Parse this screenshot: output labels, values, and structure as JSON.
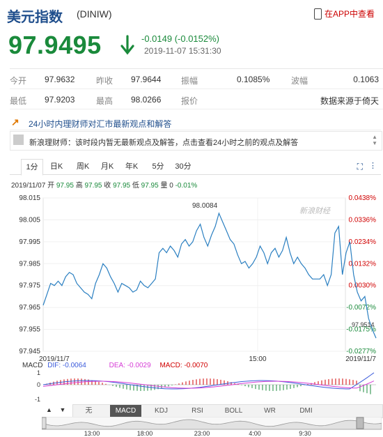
{
  "header": {
    "title": "美元指数",
    "code": "(DINIW)",
    "app_link": "在APP中查看"
  },
  "quote": {
    "price": "97.9495",
    "change": "-0.0149 (-0.0152%)",
    "timestamp": "2019-11-07 15:31:30"
  },
  "stats": {
    "row1": [
      {
        "label": "今开",
        "value": "97.9632"
      },
      {
        "label": "昨收",
        "value": "97.9644"
      },
      {
        "label": "振幅",
        "value": "0.1085%"
      },
      {
        "label": "波幅",
        "value": "0.1063"
      }
    ],
    "row2": [
      {
        "label": "最低",
        "value": "97.9203"
      },
      {
        "label": "最高",
        "value": "98.0266"
      },
      {
        "label": "报价",
        "value": ""
      },
      {
        "label": "",
        "value": "数据来源于倚天"
      }
    ]
  },
  "notice": {
    "text": "24小时内理财师对汇市最新观点和解答"
  },
  "message": {
    "text": "新浪理财师：该时段内暂无最新观点及解答，点击查看24小时之前的观点及解答"
  },
  "period_tabs": [
    "1分",
    "日K",
    "周K",
    "月K",
    "年K",
    "5分",
    "30分"
  ],
  "active_period": "1分",
  "info_line": {
    "date": "2019/11/07",
    "open_label": "开",
    "open": "97.95",
    "high_label": "高",
    "high": "97.95",
    "close_label": "收",
    "close": "97.95",
    "low_label": "低",
    "low": "97.95",
    "vol": "量 0",
    "pct": "-0.01%"
  },
  "chart_data": {
    "type": "line",
    "x_labels": [
      "2019/11/7",
      "15:00",
      "2019/11/7"
    ],
    "y_ticks": [
      "98.015",
      "98.005",
      "97.995",
      "97.985",
      "97.975",
      "97.965",
      "97.955",
      "97.945"
    ],
    "ylim": [
      97.945,
      98.015
    ],
    "right_ticks": [
      {
        "text": "0.0438%",
        "color": "#d00000"
      },
      {
        "text": "0.0336%",
        "color": "#d00000"
      },
      {
        "text": "0.0234%",
        "color": "#d00000"
      },
      {
        "text": "0.0132%",
        "color": "#d00000"
      },
      {
        "text": "0.0030%",
        "color": "#d00000"
      },
      {
        "text": "-0.0072%",
        "color": "#1a8a3b"
      },
      {
        "text": "-0.0175%",
        "color": "#1a8a3b"
      },
      {
        "text": "-0.0277%",
        "color": "#1a8a3b"
      }
    ],
    "max_label": "98.0084",
    "last_label": "97.9514",
    "watermark": "新浪财经",
    "line_color": "#2a7fc1",
    "values": [
      97.966,
      97.971,
      97.976,
      97.975,
      97.977,
      97.975,
      97.979,
      97.981,
      97.98,
      97.976,
      97.974,
      97.972,
      97.971,
      97.969,
      97.976,
      97.98,
      97.985,
      97.983,
      97.979,
      97.976,
      97.972,
      97.976,
      97.975,
      97.974,
      97.972,
      97.973,
      97.977,
      97.975,
      97.974,
      97.976,
      97.978,
      97.99,
      97.992,
      97.99,
      97.993,
      97.991,
      97.988,
      97.994,
      97.996,
      97.993,
      97.995,
      98.0,
      98.003,
      97.997,
      97.993,
      97.998,
      98.002,
      98.008,
      98.004,
      98.0,
      97.996,
      97.994,
      97.989,
      97.985,
      97.986,
      97.983,
      97.985,
      97.988,
      97.993,
      97.99,
      97.985,
      97.99,
      97.992,
      97.988,
      97.991,
      97.997,
      97.99,
      97.985,
      97.988,
      97.985,
      97.983,
      97.98,
      97.978,
      97.978,
      97.978,
      97.98,
      97.975,
      97.98,
      97.999,
      98.002,
      97.98,
      97.99,
      97.995,
      97.98,
      97.972,
      97.968,
      97.97,
      97.96,
      97.955,
      97.951
    ]
  },
  "macd": {
    "label": "MACD",
    "dif_label": "DIF: -0.0064",
    "dea_label": "DEA: -0.0029",
    "macd_label": "MACD: -0.0070",
    "y_ticks": [
      "1",
      "0",
      "-1"
    ],
    "dif_color": "#3b5bdb",
    "dea_color": "#d63cd6",
    "macd_color": "#d00000"
  },
  "navigator": {
    "labels": [
      "13:00",
      "18:00",
      "23:00",
      "4:00",
      "9:30"
    ]
  },
  "indicator_tabs": [
    "无",
    "MACD",
    "KDJ",
    "RSI",
    "BOLL",
    "WR",
    "DMI"
  ],
  "active_indicator": "MACD",
  "nav_arrows": [
    "▲",
    "▼"
  ]
}
